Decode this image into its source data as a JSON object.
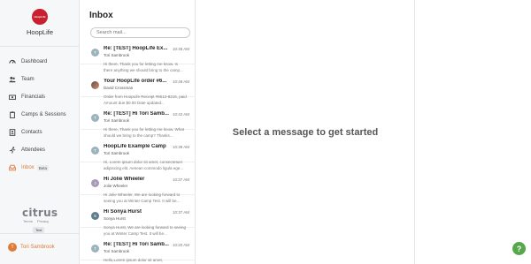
{
  "brand": {
    "logo_text": "HoopLife",
    "name": "HoopLife"
  },
  "nav": [
    {
      "label": "Dashboard",
      "icon": "speedometer-icon"
    },
    {
      "label": "Team",
      "icon": "people-icon"
    },
    {
      "label": "Financials",
      "icon": "money-icon"
    },
    {
      "label": "Camps & Sessions",
      "icon": "clipboard-icon"
    },
    {
      "label": "Contacts",
      "icon": "contact-card-icon"
    },
    {
      "label": "Attendees",
      "icon": "run-icon"
    },
    {
      "label": "Inbox",
      "icon": "inbox-icon",
      "badge": "Beta",
      "active": true
    }
  ],
  "footer": {
    "provider": "citrus",
    "terms": "Terms",
    "privacy": "Privacy",
    "env_badge": "Test",
    "user_initials": "T",
    "user_name": "Tori Sambrook"
  },
  "inbox": {
    "title": "Inbox",
    "search_placeholder": "Search mail...",
    "messages": [
      {
        "initials": "T",
        "subject": "Re: [TEST] HoopLife Ex...",
        "time": "10:48 AM",
        "from": "Tori Sambrook",
        "preview": "Hi there, Thank you for letting me know. Is there anything we should bring to the camp..."
      },
      {
        "initials": "",
        "subject": "Your HoopLife order #6...",
        "time": "10:48 AM",
        "from": "David Crossman",
        "preview": "Order from HoopLife Receipt #6512-8216, paid Amount due $0.00 Date updated..."
      },
      {
        "initials": "T",
        "subject": "Re: [TEST] Hi Tori Samb...",
        "time": "10:42 AM",
        "from": "Tori Sambrook",
        "preview": "Hi there, Thank you for letting me know. What should we bring to the camp? Thanks..."
      },
      {
        "initials": "T",
        "subject": "HoopLife Example Camp",
        "time": "10:39 AM",
        "from": "Tori Sambrook",
        "preview": "Hi, Lorem ipsum dolor sit amet, consectetuer adipiscing elit. Aenean commodo ligula ege..."
      },
      {
        "initials": "J",
        "subject": "Hi Jolie Wheeler",
        "time": "10:37 AM",
        "from": "Jolie Wheeler",
        "preview": "Hi Jolie Wheeler, We are looking forward to seeing you at Winter Camp Test. It will be..."
      },
      {
        "initials": "S",
        "subject": "Hi Sonya Hurst",
        "time": "10:37 AM",
        "from": "Sonya Hurst",
        "preview": "Sonya Hurst, We are looking forward to seeing you at Winter Camp Test. It will be..."
      },
      {
        "initials": "T",
        "subject": "Re: [TEST] Hi Tori Samb...",
        "time": "10:20 AM",
        "from": "Tori Sambrook",
        "preview": "Hello,Lorem ipsum dolor sit amet,"
      }
    ]
  },
  "main": {
    "empty_message": "Select a message to get started"
  },
  "help": {
    "label": "?"
  },
  "colors": {
    "accent": "#e07a38",
    "brand": "#c8202f",
    "help": "#56a64b"
  }
}
